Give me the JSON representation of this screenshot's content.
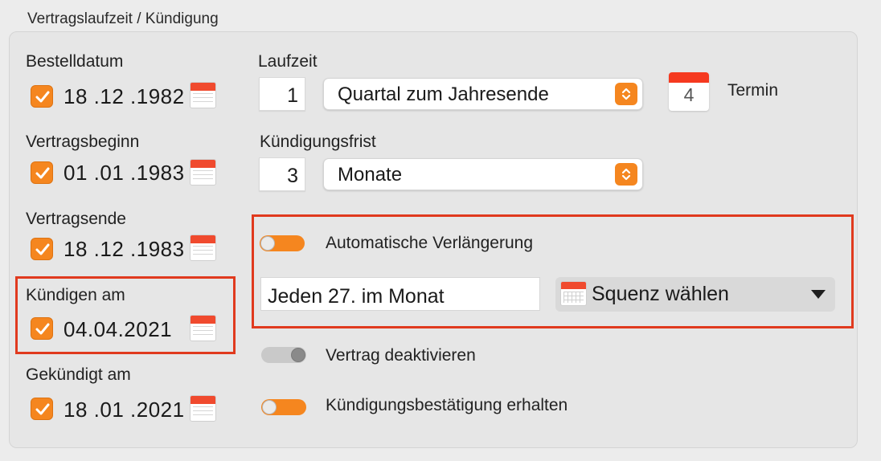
{
  "section_title": "Vertragslaufzeit / Kündigung",
  "dates": [
    {
      "label": "Bestelldatum",
      "value": "18 .12 .1982",
      "checked": true
    },
    {
      "label": "Vertragsbeginn",
      "value": "01 .01 .1983",
      "checked": true
    },
    {
      "label": "Vertragsende",
      "value": "18 .12 .1983",
      "checked": true
    },
    {
      "label": "Kündigen am",
      "value": "04.04.2021",
      "checked": true
    },
    {
      "label": "Gekündigt am",
      "value": "18 .01 .2021",
      "checked": true
    }
  ],
  "laufzeit": {
    "label": "Laufzeit",
    "amount": "1",
    "unit": "Quartal zum Jahresende"
  },
  "kuendigungsfrist": {
    "label": "Kündigungsfrist",
    "amount": "3",
    "unit": "Monate"
  },
  "termin": {
    "day": "4",
    "label": "Termin"
  },
  "auto_renewal": {
    "label": "Automatische Verlängerung",
    "state": "on"
  },
  "sequence": {
    "field_value": "Jeden 27. im Monat",
    "select_label": "Squenz wählen"
  },
  "deactivate": {
    "label": "Vertrag deaktivieren",
    "state": "off"
  },
  "confirmation": {
    "label": "Kündigungsbestätigung erhalten",
    "state": "on"
  },
  "colors": {
    "accent": "#f5861f",
    "highlight": "#e03a1e",
    "calendar_red": "#f04a2e"
  }
}
